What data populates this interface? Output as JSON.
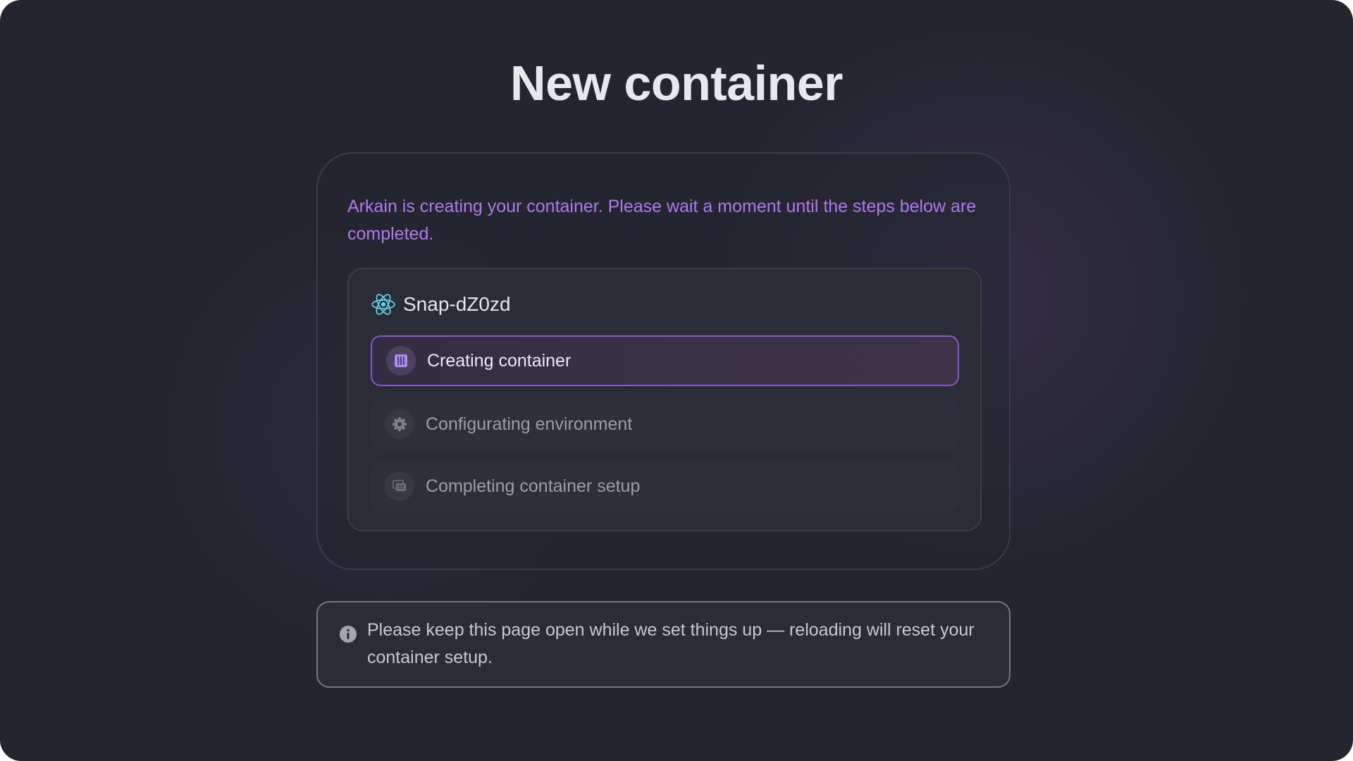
{
  "page": {
    "title": "New container"
  },
  "card": {
    "intro": "Arkain is creating your container. Please wait a moment until the steps below are completed.",
    "project": {
      "name": "Snap-dZ0zd",
      "icon": "react-icon"
    },
    "steps": [
      {
        "label": "Creating container",
        "icon": "container-icon",
        "status": "active"
      },
      {
        "label": "Configurating environment",
        "icon": "gear-icon",
        "status": "pending"
      },
      {
        "label": "Completing container setup",
        "icon": "setup-icon",
        "status": "pending"
      }
    ]
  },
  "note": {
    "icon": "info-icon",
    "text": "Please keep this page open while we set things up — reloading will reset your container setup."
  },
  "colors": {
    "background": "#23262f",
    "accent": "#b277ef",
    "active_border": "#8a58cf",
    "react": "#5fd0ea"
  }
}
